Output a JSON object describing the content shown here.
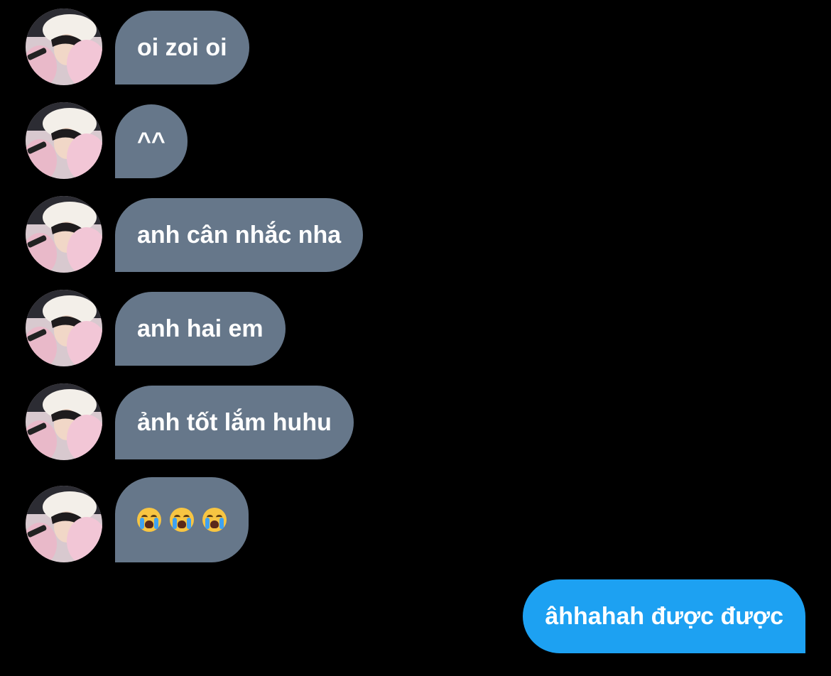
{
  "conversation": {
    "messages": [
      {
        "sender": "them",
        "text": "oi zoi oi"
      },
      {
        "sender": "them",
        "text": "^^"
      },
      {
        "sender": "them",
        "text": "anh cân nhắc nha"
      },
      {
        "sender": "them",
        "text": "anh hai em"
      },
      {
        "sender": "them",
        "text": "ảnh tốt lắm huhu"
      },
      {
        "sender": "them",
        "emoji": [
          "loudly-crying-face",
          "loudly-crying-face",
          "loudly-crying-face"
        ]
      },
      {
        "sender": "me",
        "text": "âhhahah được được"
      }
    ]
  },
  "colors": {
    "background": "#000000",
    "received_bubble": "#66778a",
    "sent_bubble": "#1da1f2",
    "text": "#ffffff"
  },
  "icons": {
    "avatar": "avatar-photo",
    "emoji": "loudly-crying-face-icon"
  }
}
